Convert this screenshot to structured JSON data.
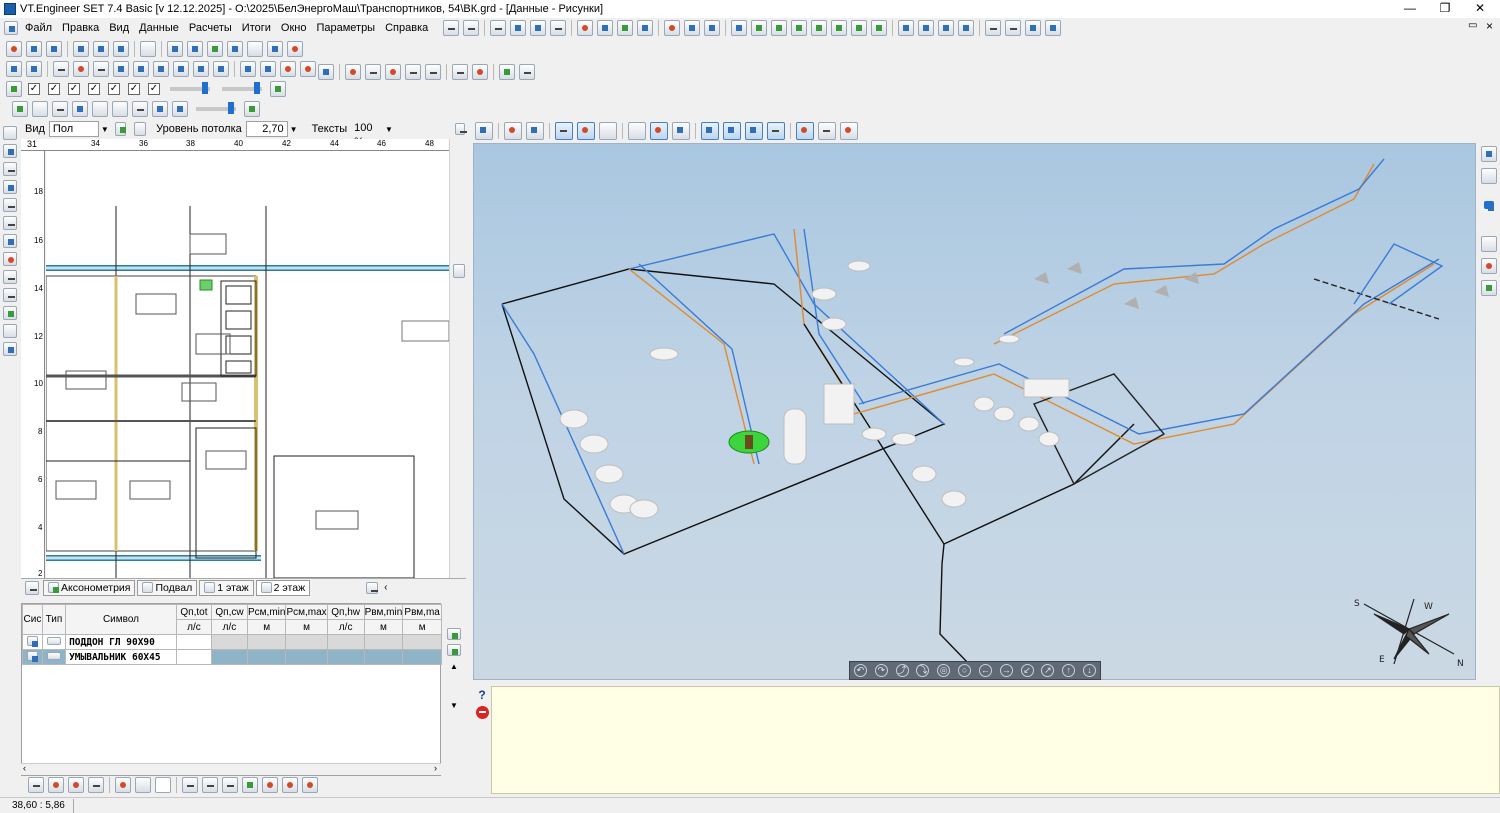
{
  "window": {
    "title": "VT.Engineer SET 7.4 Basic [v 12.12.2025] - O:\\2025\\БелЭнергоМаш\\Транспортников, 54\\ВК.grd - [Данные - Рисунки]",
    "minimize": "—",
    "maximize": "❐",
    "close": "✕",
    "inner_restore": "▭",
    "inner_close": "×"
  },
  "menu": [
    "Файл",
    "Правка",
    "Вид",
    "Данные",
    "Расчеты",
    "Итоги",
    "Окно",
    "Параметры",
    "Справка"
  ],
  "plan_props": {
    "view_label": "Вид",
    "view_value": "Пол",
    "ceiling_label": "Уровень потолка",
    "ceiling_value": "2,70",
    "texts_label": "Тексты",
    "texts_value": "100 %"
  },
  "ruler": {
    "corner": "31",
    "top_ticks": [
      "34",
      "36",
      "38",
      "40",
      "42",
      "44",
      "46",
      "48"
    ],
    "left_ticks": [
      "18",
      "16",
      "14",
      "12",
      "10",
      "8",
      "6",
      "4",
      "2"
    ]
  },
  "plan_tabs": [
    "Аксонометрия",
    "Подвал",
    "1 этаж",
    "2 этаж"
  ],
  "table": {
    "headers": [
      "Сис",
      "Тип",
      "Символ",
      "Qп,tot",
      "Qп,cw",
      "Pсм,min",
      "Pсм,max",
      "Qп,hw",
      "Pвм,min",
      "Pвм,ma"
    ],
    "units": [
      "",
      "",
      "",
      "л/с",
      "л/с",
      "м",
      "м",
      "л/с",
      "м",
      "м"
    ],
    "rows": [
      {
        "symbol": "ПОДДОН ГЛ 90X90"
      },
      {
        "symbol": "УМЫВАЛЬНИК 60X45"
      }
    ]
  },
  "status": {
    "coords": "38,60 : 5,86"
  },
  "view3d": {
    "compass_labels": [
      "S",
      "W",
      "E",
      "N"
    ]
  }
}
